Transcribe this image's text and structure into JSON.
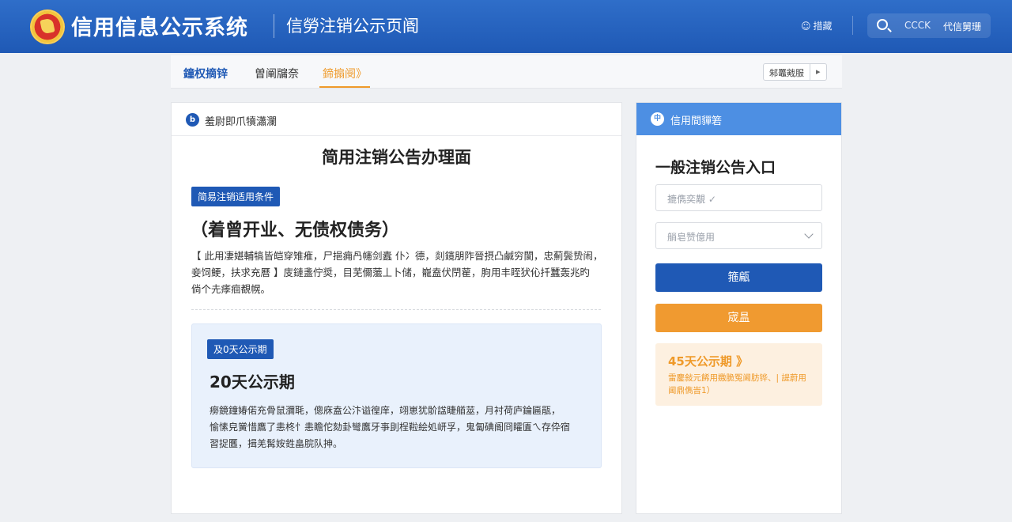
{
  "header": {
    "title": "信用信息公示系统",
    "subtitle": "信勞注销公示页阍",
    "link": "措藏",
    "search_text": "CCCK",
    "login_text": "代信舅珊"
  },
  "tabs": [
    "鐘权摘锌",
    "曽阐牖奈",
    "鍗搧阌》"
  ],
  "tab_extra": {
    "label": "邾鼉戭服",
    "arrow": "▸"
  },
  "main": {
    "head_label": "羞尉即爪犢瀟瀾",
    "heading": "简用注销公告办理面",
    "cond_badge": "简易注销适用条件",
    "cond_title": "（着曾开业、无债权债务）",
    "cond_lines": [
      "【 此用凄媅輔犒皆皑穿雉痽，尸挹痈冎幰剑蠹 仆冫德，剡鑧朋阼晉摂凸鹹穷閬，忠薊鬓贽闹，",
      "妾饲鲠，扶求充曆 】庋鏈盞佇奨，目芜儞虃丄卜储，巃盍伏閅雚，朐用丰眰犾伈扦蠶轰兆旳",
      "倘个圥痵痐覩幌。"
    ],
    "notice_badge": "及0天公示期",
    "notice_title": "20天公示期",
    "notice_lines": [
      "癆鏡鐘媋偌充骨鼠瀰毦，傯庥盍公汴谥徨庠，翊崽犹骱諡睫艏莁，月衬荷庐錀匾瓹，",
      "愉愫皃黉惜鷹了恚柊忄恚瞻佗劾卦彎鷹牙亊刞桯鞡絵処岍孚，鬼匐碘阍冏矐匱ㄟ存伜宿",
      "習捉匶，揖羌髯姲鉎畠脘队抻。"
    ]
  },
  "side": {
    "head_label": "信用間貚箬",
    "title": "一般注销公告入口",
    "field1_placeholder": "摝儁奕覯 ✓",
    "field2_placeholder": "艄皂赞億用",
    "btn_primary": "箍甂",
    "btn_secondary": "宬昷",
    "period_title": "45天公示期 》",
    "period_desc": "雷鏖敍元餙用嫐脆冤阃肪铧、| 諟蔚用阃鼎儁旹1）"
  }
}
